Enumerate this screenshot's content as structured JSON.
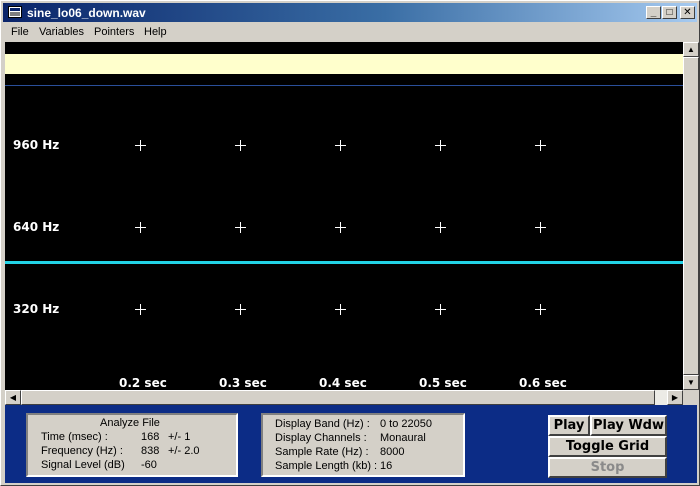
{
  "window": {
    "title": "sine_lo06_down.wav",
    "controls": {
      "minimize": "_",
      "maximize": "□",
      "close": "✕"
    }
  },
  "menu": {
    "items": [
      "File",
      "Variables",
      "Pointers",
      "Help"
    ]
  },
  "plot": {
    "freq_labels": [
      "960 Hz",
      "640 Hz",
      "320 Hz"
    ],
    "time_labels": [
      "0.2 sec",
      "0.3 sec",
      "0.4 sec",
      "0.5 sec",
      "0.6 sec"
    ],
    "colors": {
      "background": "#000000",
      "band": "#ffffcc",
      "cursor_line": "#22d3e6",
      "top_line": "#2a4f9a"
    }
  },
  "analyze_panel": {
    "title": "Analyze File",
    "rows": [
      {
        "label": "Time (msec) :",
        "value": "168",
        "err": "+/- 1"
      },
      {
        "label": "Frequency (Hz) :",
        "value": "838",
        "err": "+/- 2.0"
      },
      {
        "label": "Signal Level (dB)",
        "value": "-60",
        "err": ""
      }
    ]
  },
  "display_panel": {
    "rows": [
      {
        "label": "Display Band (Hz) :",
        "value": "0 to 22050"
      },
      {
        "label": "Display Channels :",
        "value": "Monaural"
      },
      {
        "label": "Sample Rate (Hz) :",
        "value": "8000"
      },
      {
        "label": "Sample Length (kb) :",
        "value": "16"
      }
    ]
  },
  "buttons": {
    "play": "Play",
    "play_window": "Play Wdw",
    "toggle_grid": "Toggle Grid",
    "stop": "Stop"
  },
  "scroll_arrows": {
    "up": "▲",
    "down": "▼",
    "left": "◀",
    "right": "▶"
  }
}
